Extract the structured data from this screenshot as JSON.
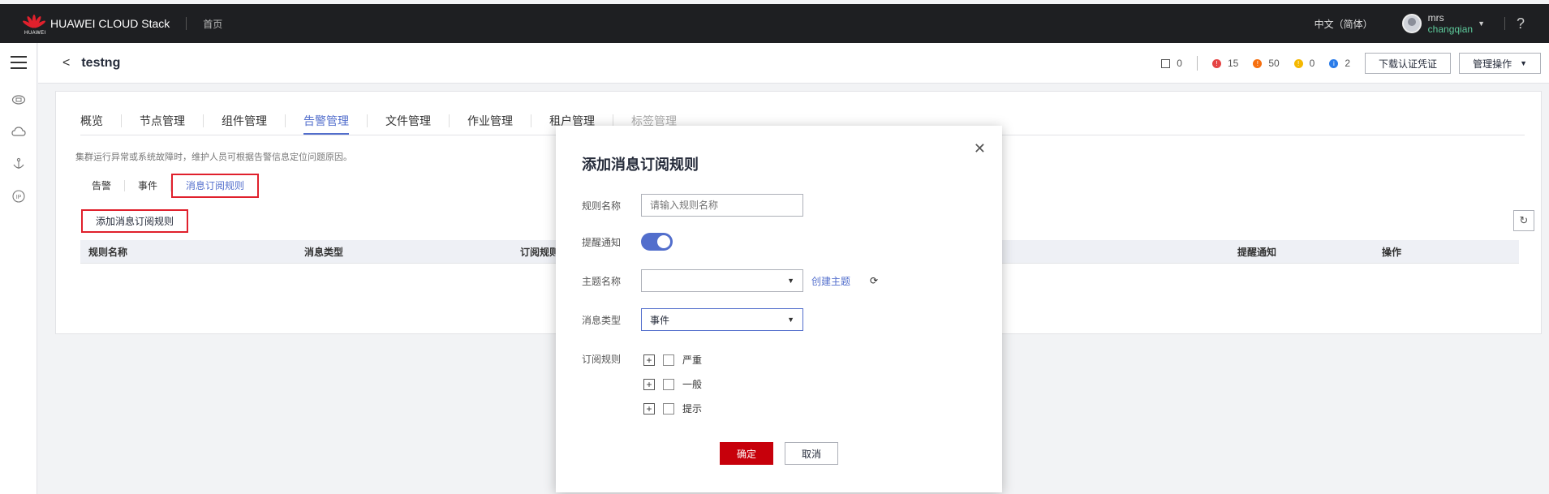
{
  "topbar": {
    "brand": "HUAWEI CLOUD Stack",
    "logo_sub": "HUAWEI",
    "home": "首页",
    "language": "中文（简体）",
    "user_line1": "mrs",
    "user_line2": "changqian",
    "help": "?"
  },
  "header": {
    "back": "<",
    "title": "testng",
    "stats": {
      "unknown_count": "0",
      "critical_count": "15",
      "major_count": "50",
      "minor_count": "0",
      "info_count": "2"
    },
    "download_btn": "下载认证凭证",
    "manage_btn": "管理操作"
  },
  "tabs": [
    "概览",
    "节点管理",
    "组件管理",
    "告警管理",
    "文件管理",
    "作业管理",
    "租户管理",
    "标签管理"
  ],
  "description": "集群运行异常或系统故障时，维护人员可根据告警信息定位问题原因。",
  "subtabs": [
    "告警",
    "事件",
    "消息订阅规则"
  ],
  "add_button": "添加消息订阅规则",
  "table": {
    "columns": [
      "规则名称",
      "消息类型",
      "订阅规则",
      "提醒通知",
      "操作"
    ]
  },
  "dialog": {
    "title": "添加消息订阅规则",
    "rule_name_label": "规则名称",
    "rule_name_placeholder": "请输入规则名称",
    "notify_label": "提醒通知",
    "topic_label": "主题名称",
    "topic_value": "",
    "create_topic": "创建主题",
    "msg_type_label": "消息类型",
    "msg_type_value": "事件",
    "rules_label": "订阅规则",
    "levels": [
      "严重",
      "一般",
      "提示"
    ],
    "ok": "确定",
    "cancel": "取消"
  },
  "colors": {
    "accent": "#526ecc",
    "brand_red": "#c7000b",
    "highlight": "#e0202c",
    "critical": "#e54545",
    "major": "#f66f0f",
    "minor": "#f5b800",
    "info": "#2b7ce9"
  }
}
